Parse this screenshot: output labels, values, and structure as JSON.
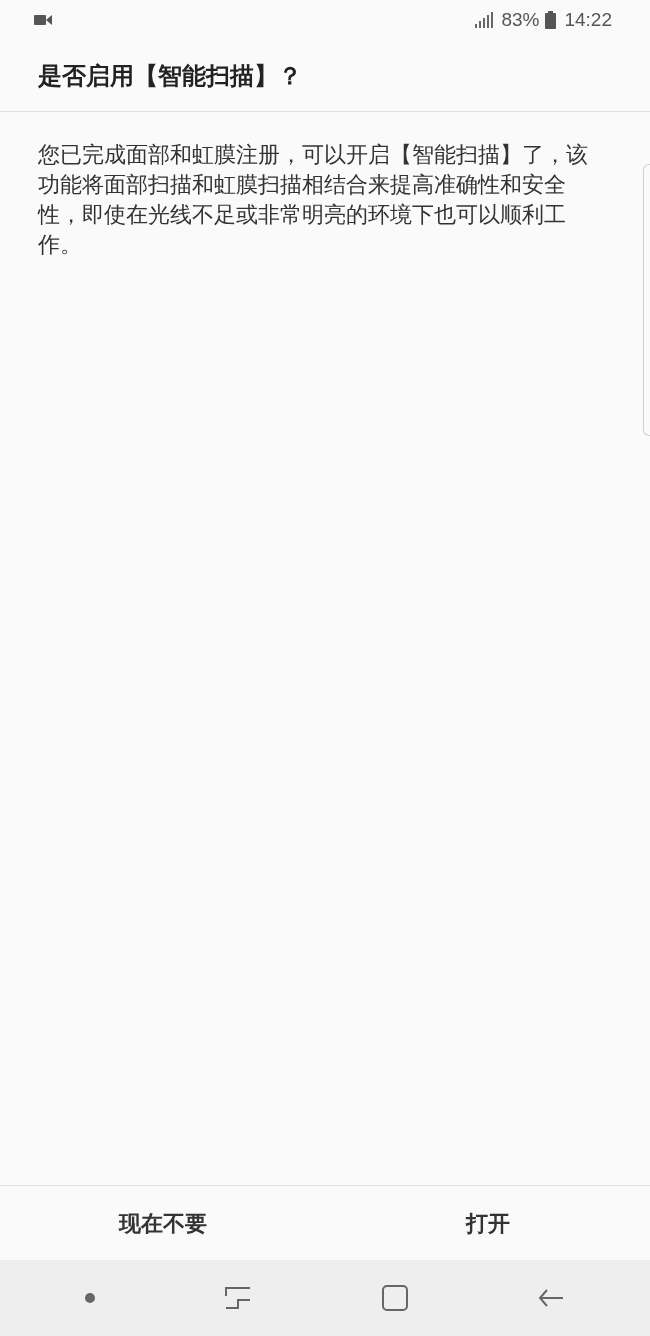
{
  "status_bar": {
    "battery": "83%",
    "time": "14:22"
  },
  "dialog": {
    "title": "是否启用【智能扫描】？",
    "message": "您已完成面部和虹膜注册，可以开启【智能扫描】了，该功能将面部扫描和虹膜扫描相结合来提高准确性和安全性，即使在光线不足或非常明亮的环境下也可以顺利工作。"
  },
  "buttons": [
    {
      "label": "现在不要"
    },
    {
      "label": "打开"
    }
  ]
}
